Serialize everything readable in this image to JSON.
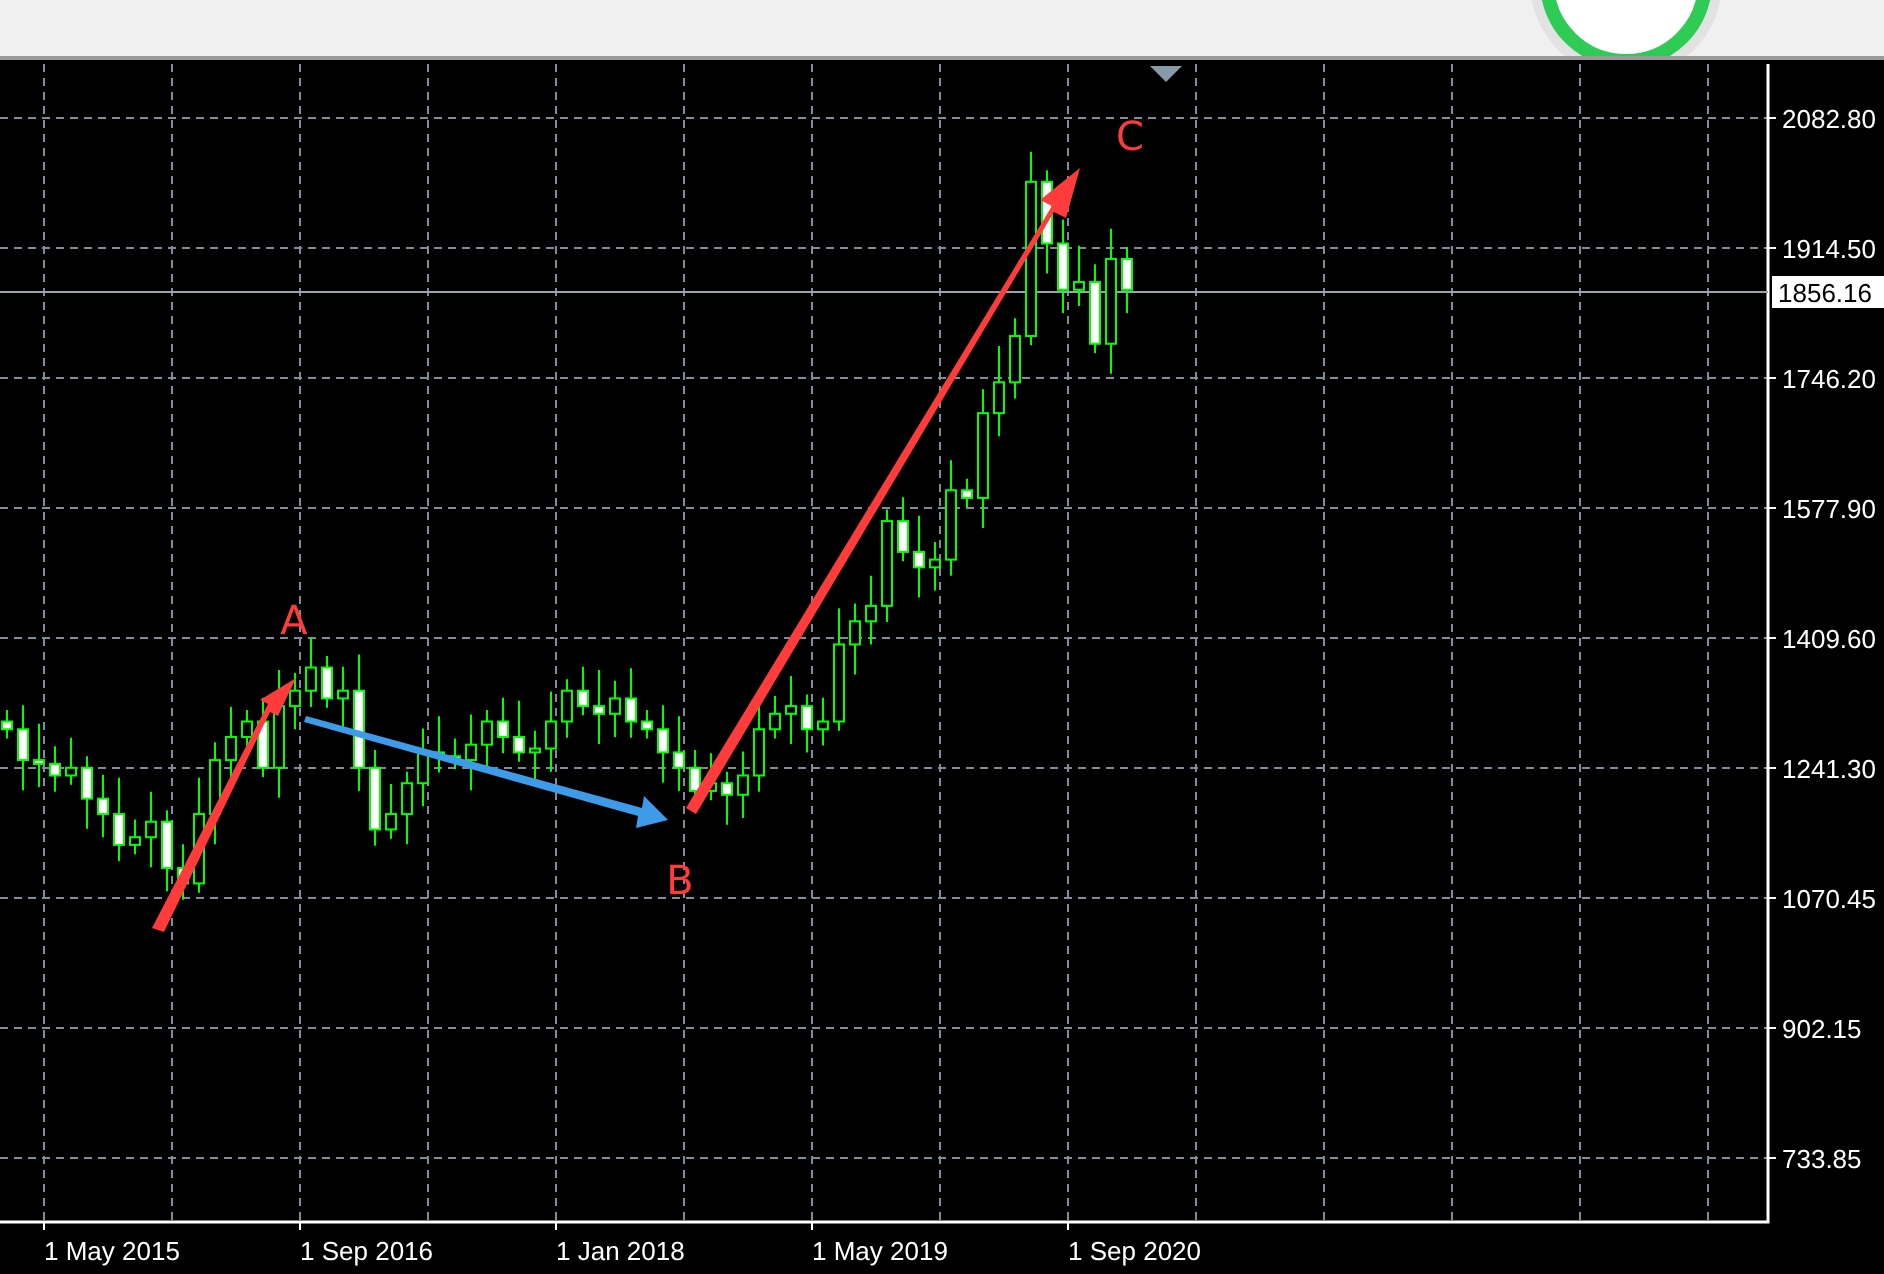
{
  "price_axis": {
    "labels": [
      "2082.80",
      "1914.50",
      "1746.20",
      "1577.90",
      "1409.60",
      "1241.30",
      "1070.45",
      "902.15",
      "733.85"
    ]
  },
  "current_price": "1856.16",
  "time_axis": {
    "labels": [
      "1 May 2015",
      "1 Sep 2016",
      "1 Jan 2018",
      "1 May 2019",
      "1 Sep 2020"
    ]
  },
  "markers": [
    "A",
    "B",
    "C"
  ]
}
